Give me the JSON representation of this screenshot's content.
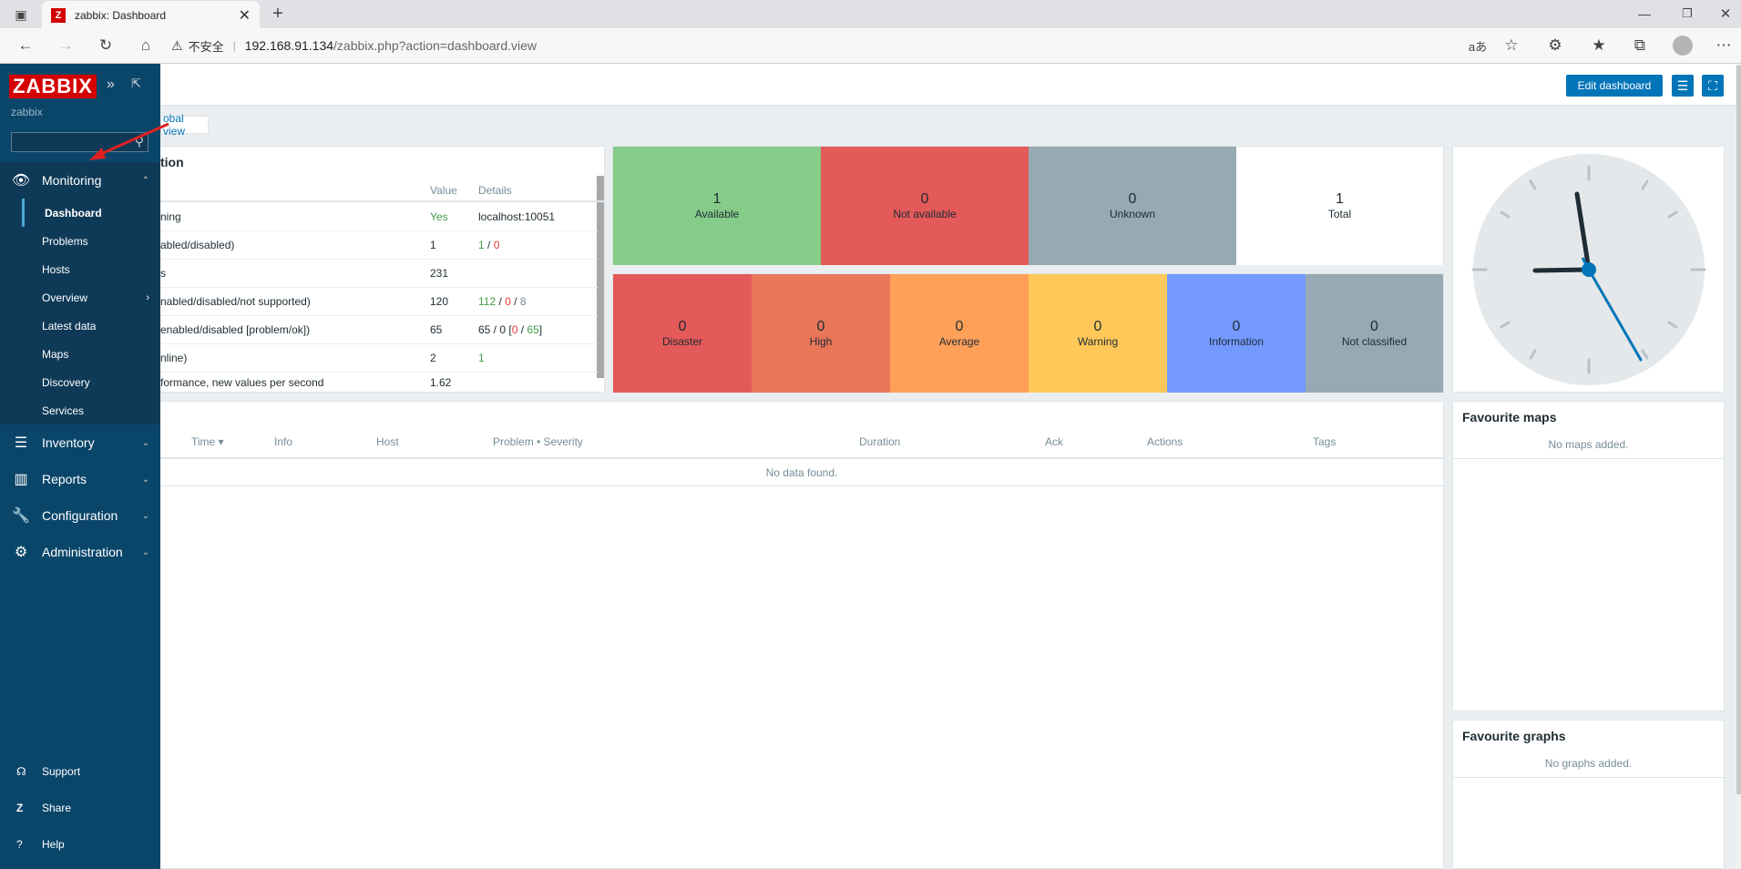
{
  "browser": {
    "tab_title": "zabbix: Dashboard",
    "favicon": "Z",
    "insecure_label": "不安全",
    "url_host": "192.168.91.134",
    "url_path": "/zabbix.php?action=dashboard.view"
  },
  "sidebar": {
    "logo": "ZABBIX",
    "server_name": "zabbix",
    "monitoring": "Monitoring",
    "sub_items": [
      "Dashboard",
      "Problems",
      "Hosts",
      "Overview",
      "Latest data",
      "Maps",
      "Discovery",
      "Services"
    ],
    "inventory": "Inventory",
    "reports": "Reports",
    "configuration": "Configuration",
    "administration": "Administration",
    "support": "Support",
    "share": "Share",
    "help": "Help"
  },
  "toolbar": {
    "edit_dashboard": "Edit dashboard"
  },
  "breadcrumb": "obal view",
  "sysinfo": {
    "title": "tion",
    "col_value": "Value",
    "col_details": "Details",
    "rows": [
      {
        "param": "ning",
        "value": "Yes",
        "details": "localhost:10051"
      },
      {
        "param": "abled/disabled)",
        "value": "1",
        "details_a": "1",
        "details_sep": " / ",
        "details_b": "0"
      },
      {
        "param": "s",
        "value": "231",
        "details": ""
      },
      {
        "param": "nabled/disabled/not supported)",
        "value": "120",
        "details_a": "112",
        "details_b": "0",
        "details_c": "8"
      },
      {
        "param": "enabled/disabled [problem/ok])",
        "value": "65",
        "details_pre": "65 / 0 [",
        "details_b": "0",
        "details_c": "65",
        "details_post": "]"
      },
      {
        "param": "nline)",
        "value": "2",
        "details_a": "1"
      },
      {
        "param": "formance, new values per second",
        "value": "1.62",
        "details": ""
      }
    ]
  },
  "host_availability": [
    {
      "count": "1",
      "label": "Available",
      "color": "#86cc89"
    },
    {
      "count": "0",
      "label": "Not available",
      "color": "#e45959"
    },
    {
      "count": "0",
      "label": "Unknown",
      "color": "#97aab3"
    },
    {
      "count": "1",
      "label": "Total",
      "color": "#ffffff"
    }
  ],
  "severity": [
    {
      "count": "0",
      "label": "Disaster",
      "color": "#e45959"
    },
    {
      "count": "0",
      "label": "High",
      "color": "#e97659"
    },
    {
      "count": "0",
      "label": "Average",
      "color": "#ffa059"
    },
    {
      "count": "0",
      "label": "Warning",
      "color": "#ffc859"
    },
    {
      "count": "0",
      "label": "Information",
      "color": "#7499ff"
    },
    {
      "count": "0",
      "label": "Not classified",
      "color": "#97aab3"
    }
  ],
  "problems": {
    "headers": [
      "Time ▾",
      "Info",
      "Host",
      "Problem • Severity",
      "Duration",
      "Ack",
      "Actions",
      "Tags"
    ],
    "empty": "No data found."
  },
  "fav_maps": {
    "title": "Favourite maps",
    "empty": "No maps added."
  },
  "fav_graphs": {
    "title": "Favourite graphs",
    "empty": "No graphs added."
  }
}
